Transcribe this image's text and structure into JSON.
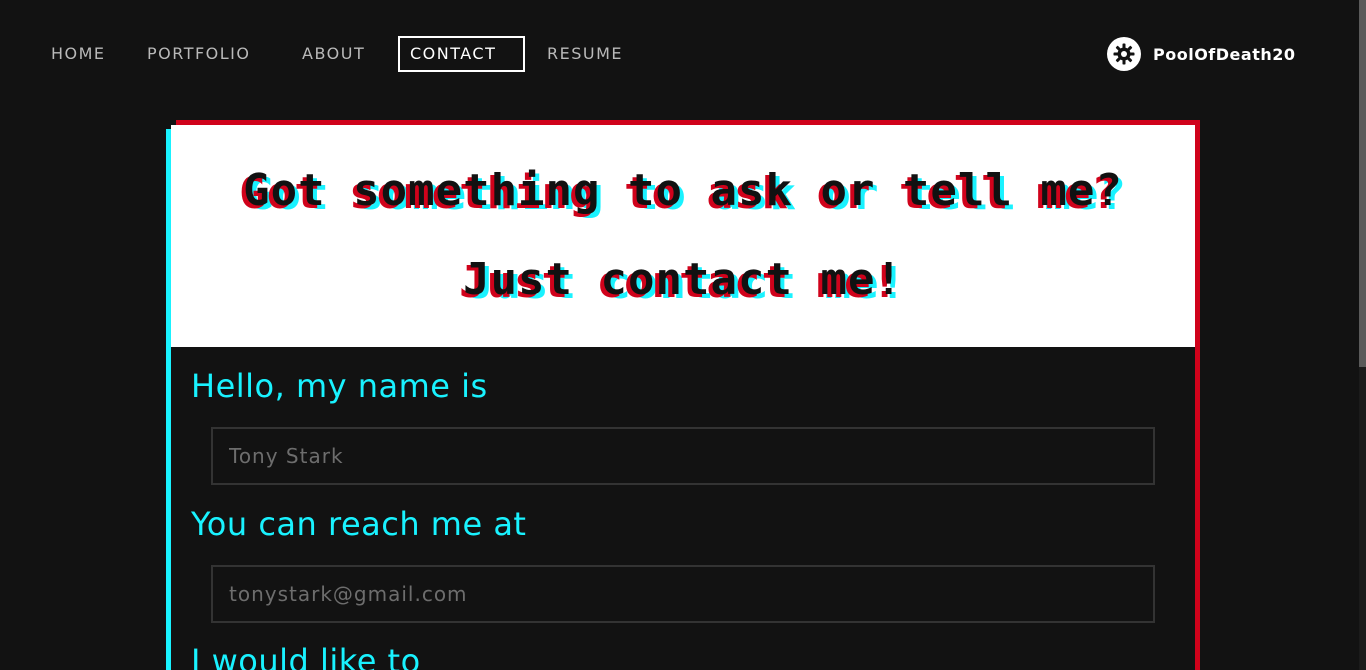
{
  "nav": {
    "links": [
      {
        "label": "HOME",
        "active": false
      },
      {
        "label": "PORTFOLIO",
        "active": false
      },
      {
        "label": "ABOUT",
        "active": false
      },
      {
        "label": "CONTACT",
        "active": true
      },
      {
        "label": "RESUME",
        "active": false
      }
    ],
    "user": {
      "name": "PoolOfDeath20",
      "icon": "gear-icon"
    }
  },
  "card": {
    "heading_line1": "Got something to ask or tell me?",
    "heading_line2": "Just contact me!"
  },
  "form": {
    "name_label": "Hello, my name is",
    "name_placeholder": "Tony Stark",
    "email_label": "You can reach me at",
    "email_placeholder": "tonystark@gmail.com",
    "message_label": "I would like to"
  },
  "colors": {
    "background": "#121212",
    "accent_cyan": "#19f2ff",
    "accent_red": "#d0021b",
    "card_header": "#ffffff"
  }
}
